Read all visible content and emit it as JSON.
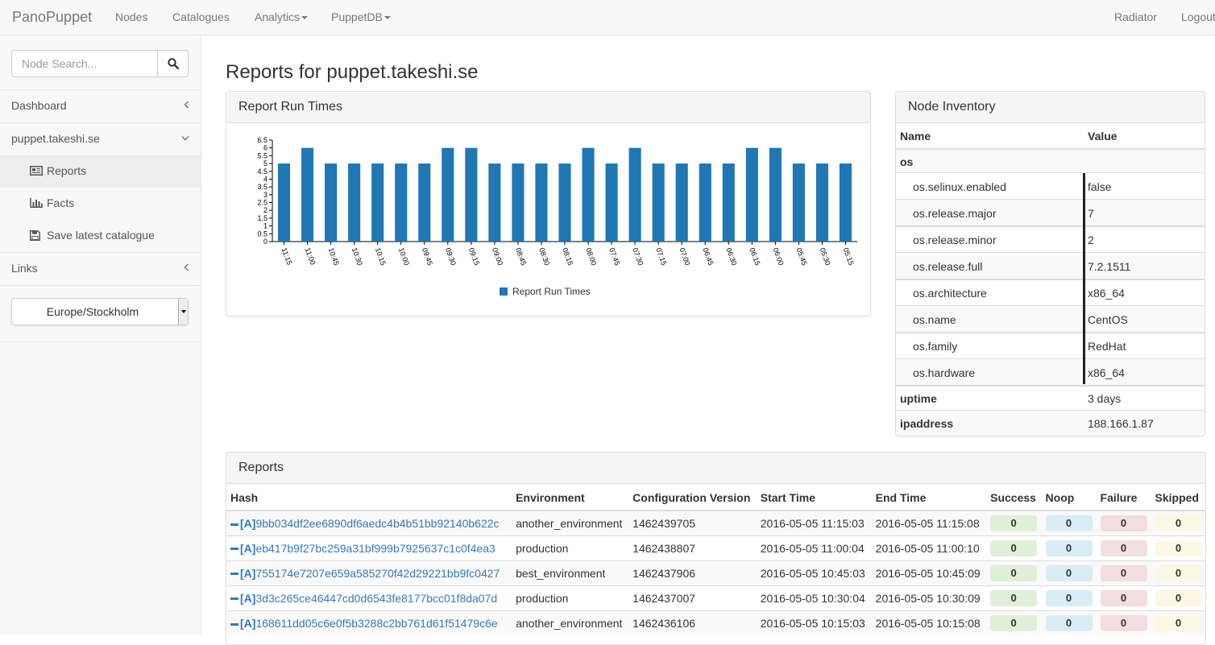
{
  "navbar": {
    "brand": "PanoPuppet",
    "items": [
      {
        "label": "Nodes"
      },
      {
        "label": "Catalogues"
      },
      {
        "label": "Analytics"
      },
      {
        "label": "PuppetDB"
      }
    ],
    "right_items": [
      {
        "label": "Radiator"
      },
      {
        "label": "Logout"
      }
    ]
  },
  "sidebar": {
    "search_placeholder": "Node Search...",
    "search_icon": "search-icon",
    "dashboard": "Dashboard",
    "node": "puppet.takeshi.se",
    "sub_items": [
      {
        "label": "Reports",
        "icon": "newspaper-icon"
      },
      {
        "label": "Facts",
        "icon": "bar-chart-icon"
      },
      {
        "label": "Save latest catalogue",
        "icon": "floppy-disk-icon"
      }
    ],
    "links": "Links",
    "timezone": "Europe/Stockholm"
  },
  "main": {
    "title": "Reports for puppet.takeshi.se"
  },
  "run_times_panel": {
    "heading": "Report Run Times"
  },
  "chart_data": {
    "type": "bar",
    "title": "",
    "xlabel": "",
    "ylabel": "",
    "ylim": [
      0,
      6.5
    ],
    "yticks": [
      "0",
      "0.5",
      "1",
      "1.5",
      "2",
      "2.5",
      "3",
      "3.5",
      "4",
      "4.5",
      "5",
      "5.5",
      "6",
      "6.5"
    ],
    "categories": [
      "11:15",
      "11:00",
      "10:45",
      "10:30",
      "10:15",
      "10:00",
      "09:45",
      "09:30",
      "09:15",
      "09:00",
      "08:45",
      "08:30",
      "08:15",
      "08:00",
      "07:45",
      "07:30",
      "07:15",
      "07:00",
      "06:45",
      "06:30",
      "06:15",
      "06:00",
      "05:45",
      "05:30",
      "05:15"
    ],
    "series": [
      {
        "name": "Report Run Times",
        "color": "#1f77b4",
        "values": [
          5,
          6,
          5,
          5,
          5,
          5,
          5,
          6,
          6,
          5,
          5,
          5,
          5,
          6,
          5,
          6,
          5,
          5,
          5,
          5,
          6,
          6,
          5,
          5,
          5
        ]
      }
    ],
    "legend": "bottom-center",
    "grid": false
  },
  "inventory": {
    "heading": "Node Inventory",
    "col_name": "Name",
    "col_value": "Value",
    "group": "os",
    "os_facts": [
      {
        "name": "os.selinux.enabled",
        "value": "false"
      },
      {
        "name": "os.release.major",
        "value": "7"
      },
      {
        "name": "os.release.minor",
        "value": "2"
      },
      {
        "name": "os.release.full",
        "value": "7.2.1511"
      },
      {
        "name": "os.architecture",
        "value": "x86_64"
      },
      {
        "name": "os.name",
        "value": "CentOS"
      },
      {
        "name": "os.family",
        "value": "RedHat"
      },
      {
        "name": "os.hardware",
        "value": "x86_64"
      }
    ],
    "facts": [
      {
        "name": "uptime",
        "value": "3 days"
      },
      {
        "name": "ipaddress",
        "value": "188.166.1.87"
      }
    ]
  },
  "reports": {
    "heading": "Reports",
    "columns": [
      "Hash",
      "Environment",
      "Configuration Version",
      "Start Time",
      "End Time",
      "Success",
      "Noop",
      "Failure",
      "Skipped"
    ],
    "hash_prefix": "[A]",
    "rows": [
      {
        "hash": "9bb034df2ee6890df6aedc4b4b51bb92140b622c",
        "environment": "another_environment",
        "version": "1462439705",
        "start": "2016-05-05 11:15:03",
        "end": "2016-05-05 11:15:08",
        "success": "0",
        "noop": "0",
        "failure": "0",
        "skipped": "0"
      },
      {
        "hash": "eb417b9f27bc259a31bf999b7925637c1c0f4ea3",
        "environment": "production",
        "version": "1462438807",
        "start": "2016-05-05 11:00:04",
        "end": "2016-05-05 11:00:10",
        "success": "0",
        "noop": "0",
        "failure": "0",
        "skipped": "0"
      },
      {
        "hash": "755174e7207e659a585270f42d29221bb9fc0427",
        "environment": "best_environment",
        "version": "1462437906",
        "start": "2016-05-05 10:45:03",
        "end": "2016-05-05 10:45:09",
        "success": "0",
        "noop": "0",
        "failure": "0",
        "skipped": "0"
      },
      {
        "hash": "3d3c265ce46447cd0d6543fe8177bcc01f8da07d",
        "environment": "production",
        "version": "1462437007",
        "start": "2016-05-05 10:30:04",
        "end": "2016-05-05 10:30:09",
        "success": "0",
        "noop": "0",
        "failure": "0",
        "skipped": "0"
      },
      {
        "hash": "168611dd05c6e0f5b3288c2bb761d61f51479c6e",
        "environment": "another_environment",
        "version": "1462436106",
        "start": "2016-05-05 10:15:03",
        "end": "2016-05-05 10:15:08",
        "success": "0",
        "noop": "0",
        "failure": "0",
        "skipped": "0"
      }
    ],
    "badge_colors": {
      "success": "#dff0d8",
      "noop": "#d9edf7",
      "failure": "#f2dede",
      "skipped": "#fcf8e3"
    }
  }
}
